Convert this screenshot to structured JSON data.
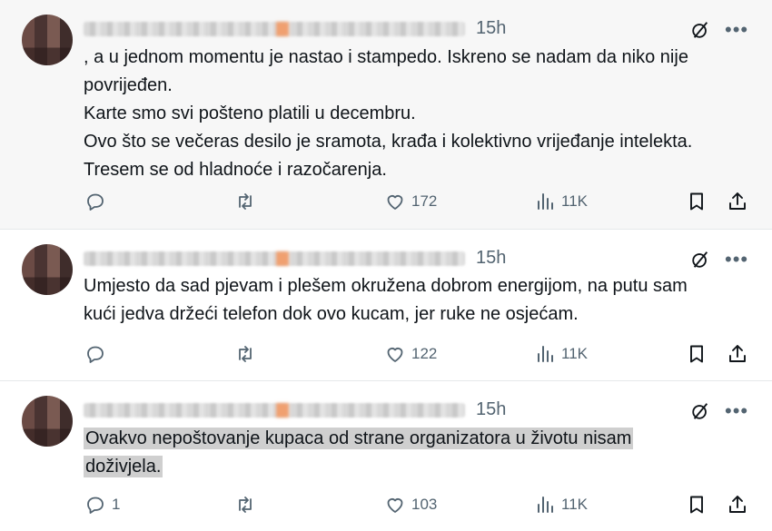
{
  "tweets": [
    {
      "time": "15h",
      "text_lines": [
        ", a u jednom momentu je nastao i stampedo. Iskreno se nadam da niko nije",
        "povrijeđen.",
        "Karte smo svi pošteno platili u decembru.",
        "Ovo što se večeras desilo je sramota, krađa i kolektivno vrijeđanje intelekta.",
        "Tresem se od hladnoće i razočarenja."
      ],
      "reply_count": "",
      "like_count": "172",
      "view_count": "11K"
    },
    {
      "time": "15h",
      "text_lines": [
        "Umjesto da sad pjevam i plešem okružena dobrom energijom, na putu sam",
        "kući jedva držeći telefon dok ovo kucam, jer ruke ne osjećam."
      ],
      "reply_count": "",
      "like_count": "122",
      "view_count": "11K"
    },
    {
      "time": "15h",
      "text_lines": [
        "Ovakvo nepoštovanje kupaca od strane organizatora u životu nisam",
        "doživjela."
      ],
      "reply_count": "1",
      "like_count": "103",
      "view_count": "11K"
    }
  ],
  "icons": {
    "reply": "reply-icon",
    "repost": "repost-icon",
    "like": "heart-icon",
    "views": "views-icon",
    "bookmark": "bookmark-icon",
    "share": "share-icon",
    "grok": "grok-icon",
    "more": "more-icon"
  },
  "colors": {
    "text": "#0f1419",
    "muted": "#536471",
    "highlight": "#cfcfcf"
  }
}
